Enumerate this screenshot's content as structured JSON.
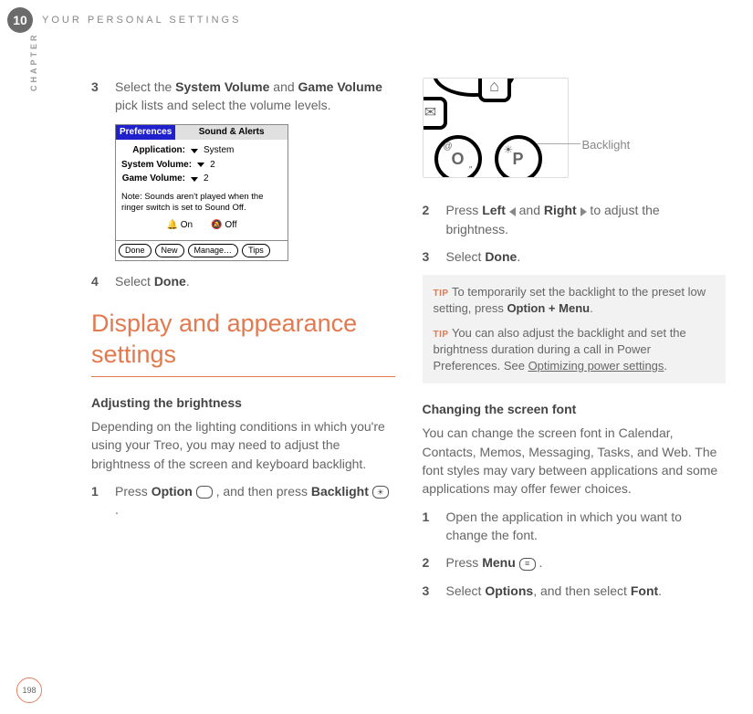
{
  "chapter": {
    "number": "10",
    "label": "CHAPTER",
    "title": "YOUR PERSONAL SETTINGS"
  },
  "pageNumber": "198",
  "left": {
    "step3": {
      "num": "3",
      "pre": "Select the ",
      "b1": "System Volume",
      "mid": " and ",
      "b2": "Game Volume",
      "post": " pick lists and select the volume levels."
    },
    "screenshot": {
      "titleLeft": "Preferences",
      "titleRight": "Sound & Alerts",
      "rows": {
        "app": {
          "label": "Application:",
          "value": "System"
        },
        "sys": {
          "label": "System Volume:",
          "value": "2"
        },
        "game": {
          "label": "Game Volume:",
          "value": "2"
        }
      },
      "note": "Note: Sounds aren't played when the ringer switch is set to Sound Off.",
      "radio": {
        "on": "On",
        "off": "Off"
      },
      "buttons": {
        "done": "Done",
        "new": "New",
        "manage": "Manage…",
        "tips": "Tips"
      }
    },
    "step4": {
      "num": "4",
      "pre": "Select ",
      "b1": "Done",
      "post": "."
    },
    "heading": "Display and appearance settings",
    "sub1": "Adjusting the brightness",
    "para1": "Depending on the lighting conditions in which you're using your Treo, you may need to adjust the brightness of the screen and keyboard backlight.",
    "step1b": {
      "num": "1",
      "pre": "Press ",
      "b1": "Option",
      "mid": " , and then press ",
      "b2": "Backlight",
      "post": " ."
    }
  },
  "right": {
    "device": {
      "keyO": "O",
      "keyP": "P",
      "at": "@",
      "quote": "\"",
      "callout": "Backlight"
    },
    "step2": {
      "num": "2",
      "pre": "Press ",
      "b1": "Left",
      "mid": " and ",
      "b2": "Right",
      "post": " to adjust the brightness."
    },
    "step3": {
      "num": "3",
      "pre": "Select ",
      "b1": "Done",
      "post": "."
    },
    "tips": {
      "label": "TIP",
      "t1a": "To temporarily set the backlight to the preset low setting, press ",
      "t1b": "Option + Menu",
      "t1c": ".",
      "t2a": "You can also adjust the backlight and set the brightness duration during a call in Power Preferences. See ",
      "t2link": "Optimizing power settings",
      "t2c": "."
    },
    "sub2": "Changing the screen font",
    "para2": "You can change the screen font in Calendar, Contacts, Memos, Messaging, Tasks, and Web. The font styles may vary between applications and some applications may offer fewer choices.",
    "s1": {
      "num": "1",
      "text": "Open the application in which you want to change the font."
    },
    "s2": {
      "num": "2",
      "pre": "Press ",
      "b1": "Menu",
      "post": " ."
    },
    "s3": {
      "num": "3",
      "pre": "Select ",
      "b1": "Options",
      "mid": ", and then select ",
      "b2": "Font",
      "post": "."
    }
  }
}
